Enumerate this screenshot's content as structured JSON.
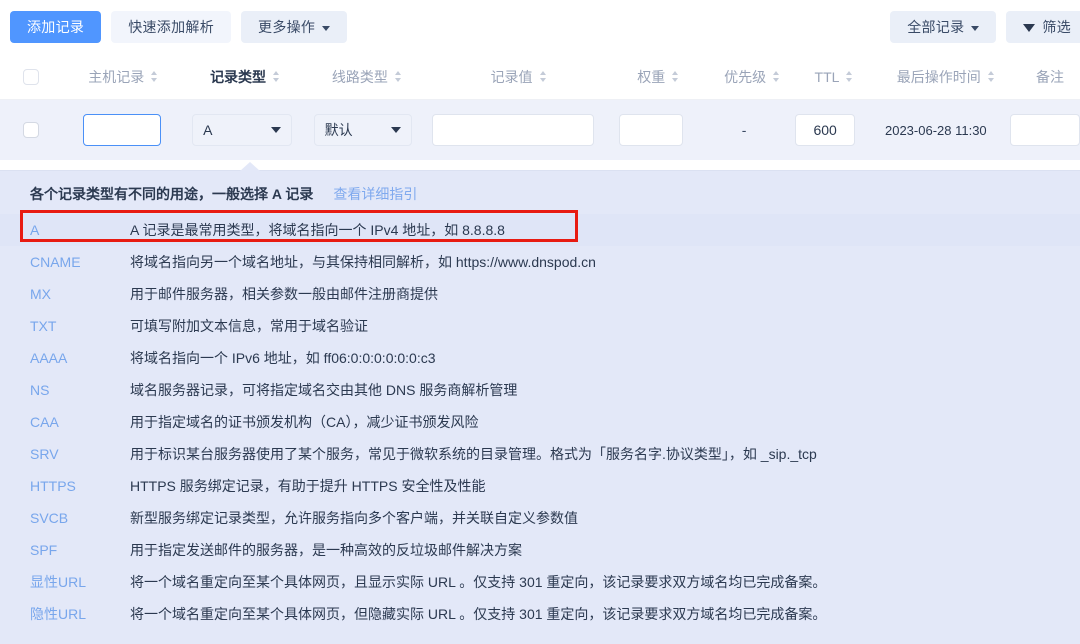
{
  "toolbar": {
    "add_record_label": "添加记录",
    "quick_add_label": "快速添加解析",
    "more_actions_label": "更多操作",
    "all_records_label": "全部记录",
    "filter_label": "筛选"
  },
  "table": {
    "columns": [
      {
        "label": "主机记录",
        "sortable": true,
        "active": false
      },
      {
        "label": "记录类型",
        "sortable": true,
        "active": true
      },
      {
        "label": "线路类型",
        "sortable": true,
        "active": false
      },
      {
        "label": "记录值",
        "sortable": true,
        "active": false
      },
      {
        "label": "权重",
        "sortable": true,
        "active": false
      },
      {
        "label": "优先级",
        "sortable": true,
        "active": false
      },
      {
        "label": "TTL",
        "sortable": true,
        "active": false
      },
      {
        "label": "最后操作时间",
        "sortable": true,
        "active": false
      },
      {
        "label": "备注",
        "sortable": false,
        "active": false
      }
    ],
    "edit_row": {
      "host_value": "",
      "host_placeholder": "",
      "record_type_value": "A",
      "line_type_value": "默认",
      "record_value": "",
      "record_value_placeholder": "",
      "weight_value": "",
      "priority_value": "-",
      "ttl_value": "600",
      "last_modified": "2023-06-28 11:30",
      "remark_value": ""
    }
  },
  "type_panel": {
    "title": "各个记录类型有不同的用途，一般选择 A 记录",
    "guide_link": "查看详细指引",
    "selected_code": "A",
    "rows": [
      {
        "code": "A",
        "desc": "A 记录是最常用类型，将域名指向一个 IPv4 地址，如 8.8.8.8"
      },
      {
        "code": "CNAME",
        "desc": "将域名指向另一个域名地址，与其保持相同解析，如 https://www.dnspod.cn"
      },
      {
        "code": "MX",
        "desc": "用于邮件服务器，相关参数一般由邮件注册商提供"
      },
      {
        "code": "TXT",
        "desc": "可填写附加文本信息，常用于域名验证"
      },
      {
        "code": "AAAA",
        "desc": "将域名指向一个 IPv6 地址，如 ff06:0:0:0:0:0:0:c3"
      },
      {
        "code": "NS",
        "desc": "域名服务器记录，可将指定域名交由其他 DNS 服务商解析管理"
      },
      {
        "code": "CAA",
        "desc": "用于指定域名的证书颁发机构（CA），减少证书颁发风险"
      },
      {
        "code": "SRV",
        "desc": "用于标识某台服务器使用了某个服务，常见于微软系统的目录管理。格式为「服务名字.协议类型」，如 _sip._tcp"
      },
      {
        "code": "HTTPS",
        "desc": "HTTPS 服务绑定记录，有助于提升 HTTPS 安全性及性能"
      },
      {
        "code": "SVCB",
        "desc": "新型服务绑定记录类型，允许服务指向多个客户端，并关联自定义参数值"
      },
      {
        "code": "SPF",
        "desc": "用于指定发送邮件的服务器，是一种高效的反垃圾邮件解决方案"
      },
      {
        "code": "显性URL",
        "desc": "将一个域名重定向至某个具体网页，且显示实际 URL 。仅支持 301 重定向，该记录要求双方域名均已完成备案。"
      },
      {
        "code": "隐性URL",
        "desc": "将一个域名重定向至某个具体网页，但隐藏实际 URL 。仅支持 301 重定向，该记录要求双方域名均已完成备案。"
      }
    ]
  },
  "colors": {
    "primary": "#5096ff",
    "panel_bg": "#e3e8f8",
    "edit_row_bg": "#eef1fa",
    "code_text": "#78a6ec",
    "annotation": "#e81b12"
  }
}
